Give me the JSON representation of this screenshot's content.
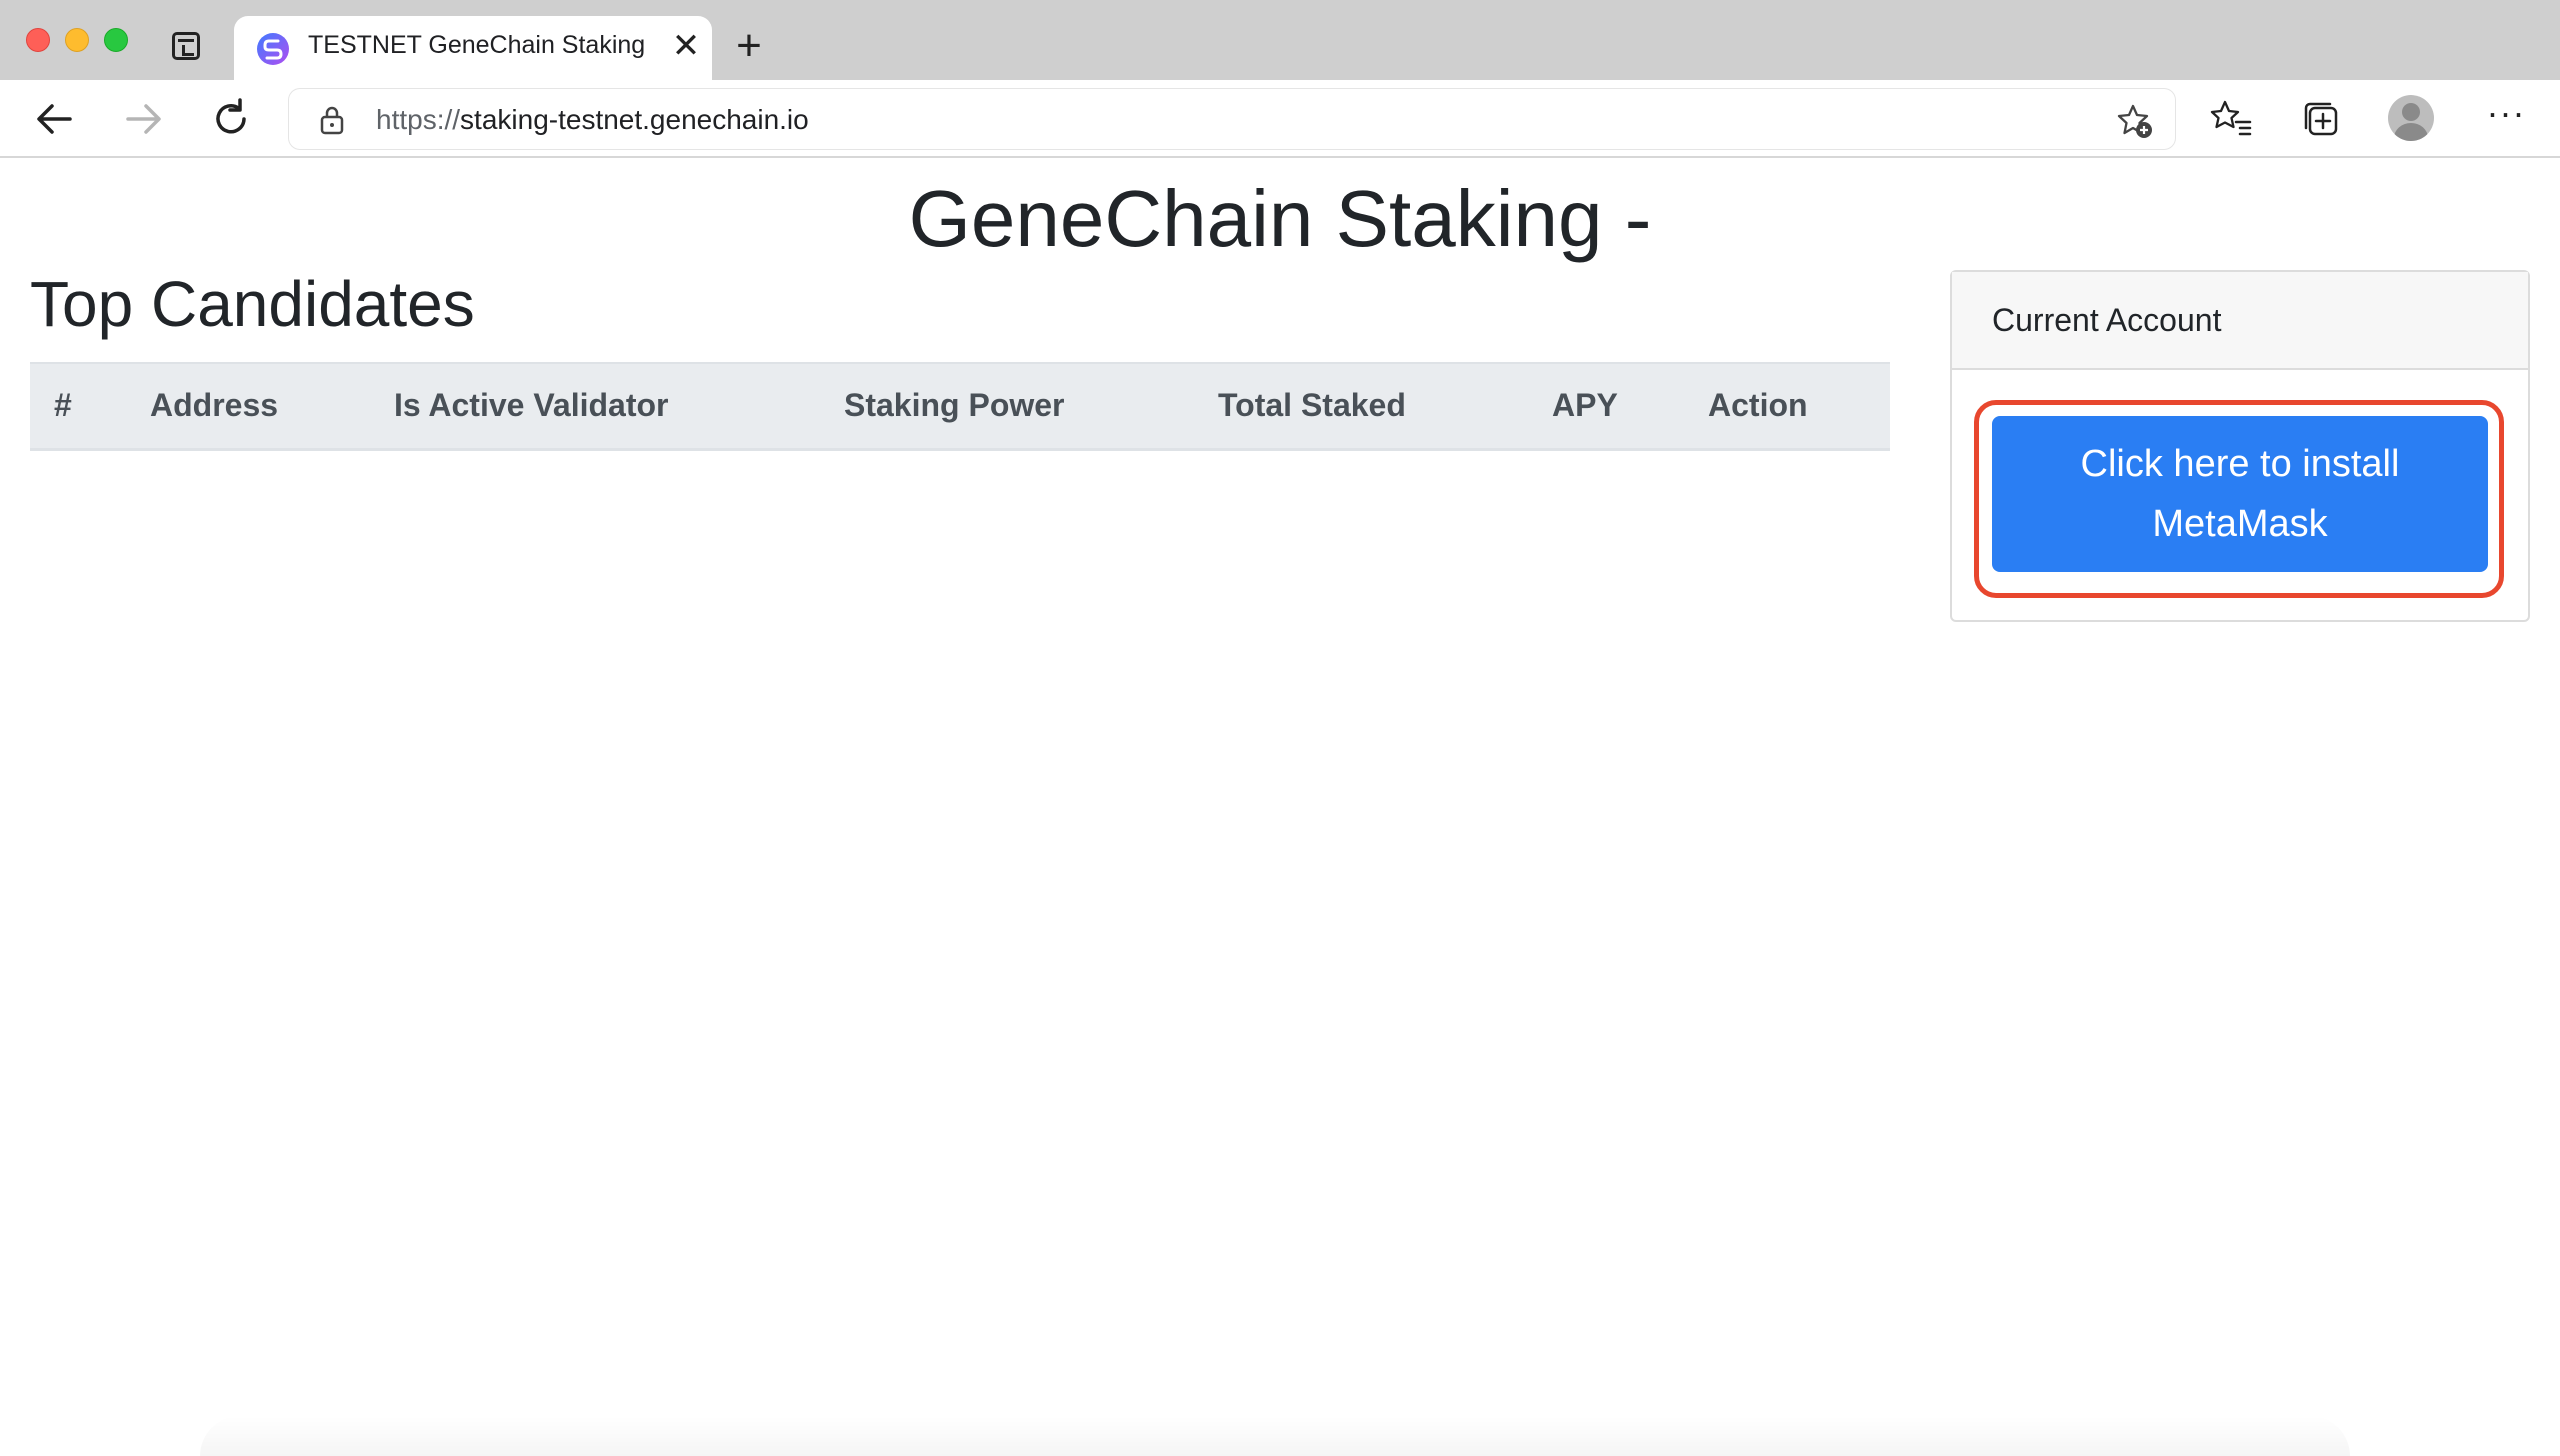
{
  "browser": {
    "tab": {
      "title": "TESTNET GeneChain Staking",
      "close_glyph": "✕"
    },
    "new_tab_glyph": "+",
    "address": {
      "protocol": "https://",
      "host": "staking-testnet.genechain.io"
    },
    "more_glyph": "···",
    "icons": {
      "back": "back-arrow-icon",
      "forward": "forward-arrow-icon",
      "refresh": "refresh-icon",
      "lock": "lock-icon",
      "add_favorite": "star-plus-icon",
      "favorites": "favorites-list-icon",
      "collections": "collections-icon",
      "profile": "profile-avatar-icon",
      "more": "more-horizontal-icon",
      "tab_actions": "tab-actions-icon"
    }
  },
  "page": {
    "title": "GeneChain Staking -",
    "section_title": "Top Candidates",
    "table": {
      "headers": [
        "#",
        "Address",
        "Is Active Validator",
        "Staking Power",
        "Total Staked",
        "APY",
        "Action"
      ],
      "rows": []
    },
    "account_card": {
      "header": "Current Account",
      "install_button_label": "Click here to install MetaMask"
    }
  },
  "colors": {
    "primary_button": "#2a7ef3",
    "highlight_ring": "#e8472e",
    "table_header_bg": "#e9ecef"
  }
}
